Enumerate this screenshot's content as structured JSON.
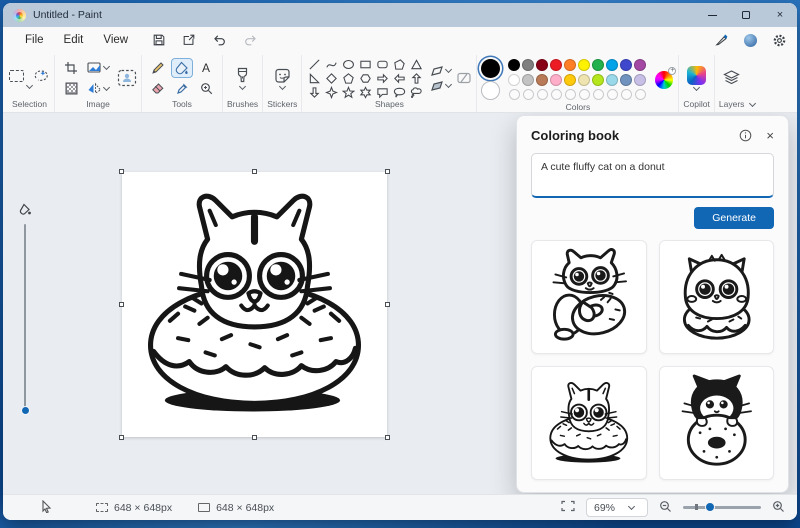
{
  "window": {
    "title": "Untitled - Paint",
    "controls": {
      "minimize": "minimize",
      "maximize": "maximize",
      "close": "close",
      "close_glyph": "×"
    }
  },
  "menubar": {
    "items": [
      {
        "label": "File"
      },
      {
        "label": "Edit"
      },
      {
        "label": "View"
      }
    ],
    "quick_icons": [
      "save-icon",
      "share-icon",
      "undo-icon",
      "redo-icon"
    ],
    "right_icons": [
      "stylus-icon",
      "account-icon",
      "settings-gear-icon"
    ]
  },
  "ribbon": {
    "groups": [
      {
        "label": "Selection"
      },
      {
        "label": "Image"
      },
      {
        "label": "Tools"
      },
      {
        "label": "Brushes"
      },
      {
        "label": "Stickers"
      },
      {
        "label": "Shapes"
      },
      {
        "label": "Colors"
      },
      {
        "label": "Copilot"
      },
      {
        "label": "Layers"
      }
    ],
    "selected_tool": "fill",
    "color1": "#000000",
    "color2": "#ffffff",
    "palette_row1": [
      "#000000",
      "#7f7f7f",
      "#880015",
      "#ed1c24",
      "#ff7f27",
      "#fff200",
      "#22b14c",
      "#00a2e8",
      "#3f48cc",
      "#a349a4"
    ],
    "palette_row2": [
      "#ffffff",
      "#c3c3c3",
      "#b97a57",
      "#ffaec9",
      "#ffc90e",
      "#efe4b0",
      "#b5e61d",
      "#99d9ea",
      "#7092be",
      "#c8bfe7"
    ],
    "palette_empty_slots": 10,
    "shapes": [
      "line",
      "curve",
      "oval",
      "rectangle",
      "rounded-rectangle",
      "polygon",
      "triangle",
      "right-triangle",
      "diamond",
      "pentagon",
      "hexagon",
      "arrow-right",
      "arrow-left",
      "arrow-up",
      "arrow-down",
      "four-point-star",
      "five-point-star",
      "six-point-star",
      "speech-bubble",
      "oval-callout",
      "cloud-callout"
    ]
  },
  "panel": {
    "title": "Coloring book",
    "prompt": "A cute fluffy cat on a donut",
    "generate_label": "Generate",
    "accent_color": "#1267b4",
    "thumbnails": [
      {
        "name": "cat-hugging-donut"
      },
      {
        "name": "round-cat-on-donut"
      },
      {
        "name": "cat-head-in-donut"
      },
      {
        "name": "tuxedo-cat-behind-donut"
      }
    ]
  },
  "canvas": {
    "content": "cat-head-in-donut-line-art"
  },
  "statusbar": {
    "selection_size": "648 × 648px",
    "canvas_size": "648 × 648px",
    "zoom_level": "69%"
  }
}
